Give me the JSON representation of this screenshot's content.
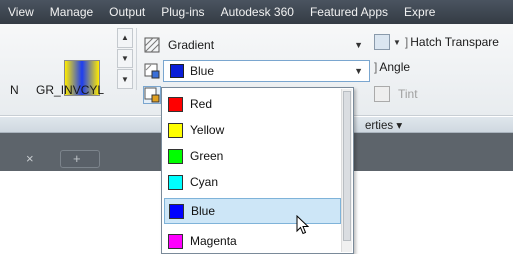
{
  "menubar": {
    "tabs": [
      "View",
      "Manage",
      "Output",
      "Plug-ins",
      "Autodesk 360",
      "Featured Apps",
      "Expre"
    ]
  },
  "gallery": {
    "left_fragment": "N",
    "pattern_name": "GR_INVCYL"
  },
  "hatch_type": {
    "value": "Gradient"
  },
  "color1": {
    "value": "Blue",
    "color": "#0a1ed8"
  },
  "transparency": {
    "label": "Hatch Transpare"
  },
  "angle": {
    "label": "Angle"
  },
  "tint": {
    "label": "Tint"
  },
  "properties_panel": {
    "label": "erties ▾"
  },
  "dropdown": {
    "items": [
      {
        "label": "Red",
        "color": "#ff0000"
      },
      {
        "label": "Yellow",
        "color": "#ffff00"
      },
      {
        "label": "Green",
        "color": "#00ff00"
      },
      {
        "label": "Cyan",
        "color": "#00ffff"
      },
      {
        "label": "Blue",
        "color": "#0000ff",
        "selected": true
      },
      {
        "label": "Magenta",
        "color": "#ff00ff"
      }
    ]
  },
  "doc_tabs": {
    "close_symbol": "×",
    "plus_symbol": "+"
  }
}
